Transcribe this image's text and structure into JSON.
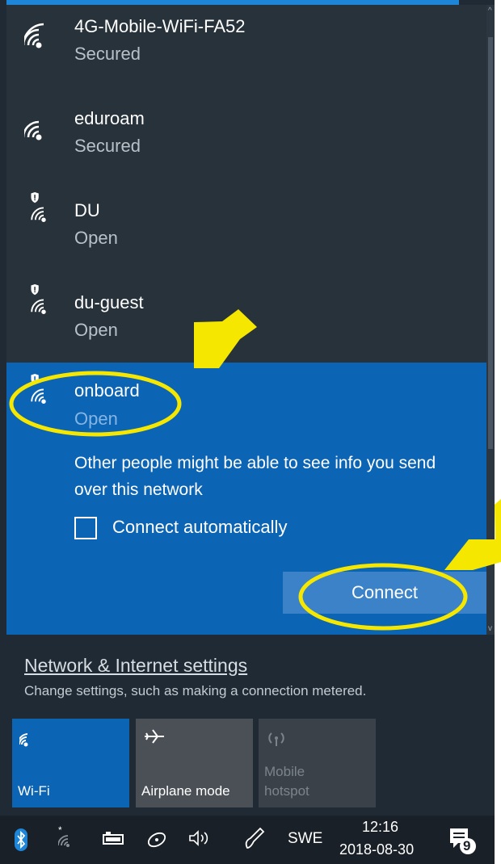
{
  "networks": [
    {
      "name": "4G-Mobile-WiFi-FA52",
      "status": "Secured",
      "shield": false
    },
    {
      "name": "eduroam",
      "status": "Secured",
      "shield": false
    },
    {
      "name": "DU",
      "status": "Open",
      "shield": true
    },
    {
      "name": "du-guest",
      "status": "Open",
      "shield": true
    }
  ],
  "selected_network": {
    "name": "onboard",
    "status": "Open",
    "warning": "Other people might be able to see info you send over this network",
    "connect_auto_label": "Connect automatically",
    "connect_auto_checked": false,
    "connect_button": "Connect"
  },
  "settings": {
    "link": "Network & Internet settings",
    "subtitle": "Change settings, such as making a connection metered."
  },
  "quick_actions": [
    {
      "label": "Wi-Fi",
      "icon": "wifi-icon",
      "active": true
    },
    {
      "label": "Airplane mode",
      "icon": "airplane-icon",
      "active": false
    },
    {
      "label": "Mobile hotspot",
      "icon": "hotspot-icon",
      "active": false,
      "disabled": true
    }
  ],
  "taskbar": {
    "language": "SWE",
    "time": "12:16",
    "date": "2018-08-30",
    "notification_count": "9",
    "icons": [
      "bluetooth-icon",
      "wifi-icon",
      "battery-icon",
      "satellite-icon",
      "volume-icon",
      "pen-icon",
      "notification-icon"
    ]
  },
  "colors": {
    "selected_bg": "#0c64b5",
    "list_bg": "#27323b",
    "annotation": "#f5e700"
  }
}
